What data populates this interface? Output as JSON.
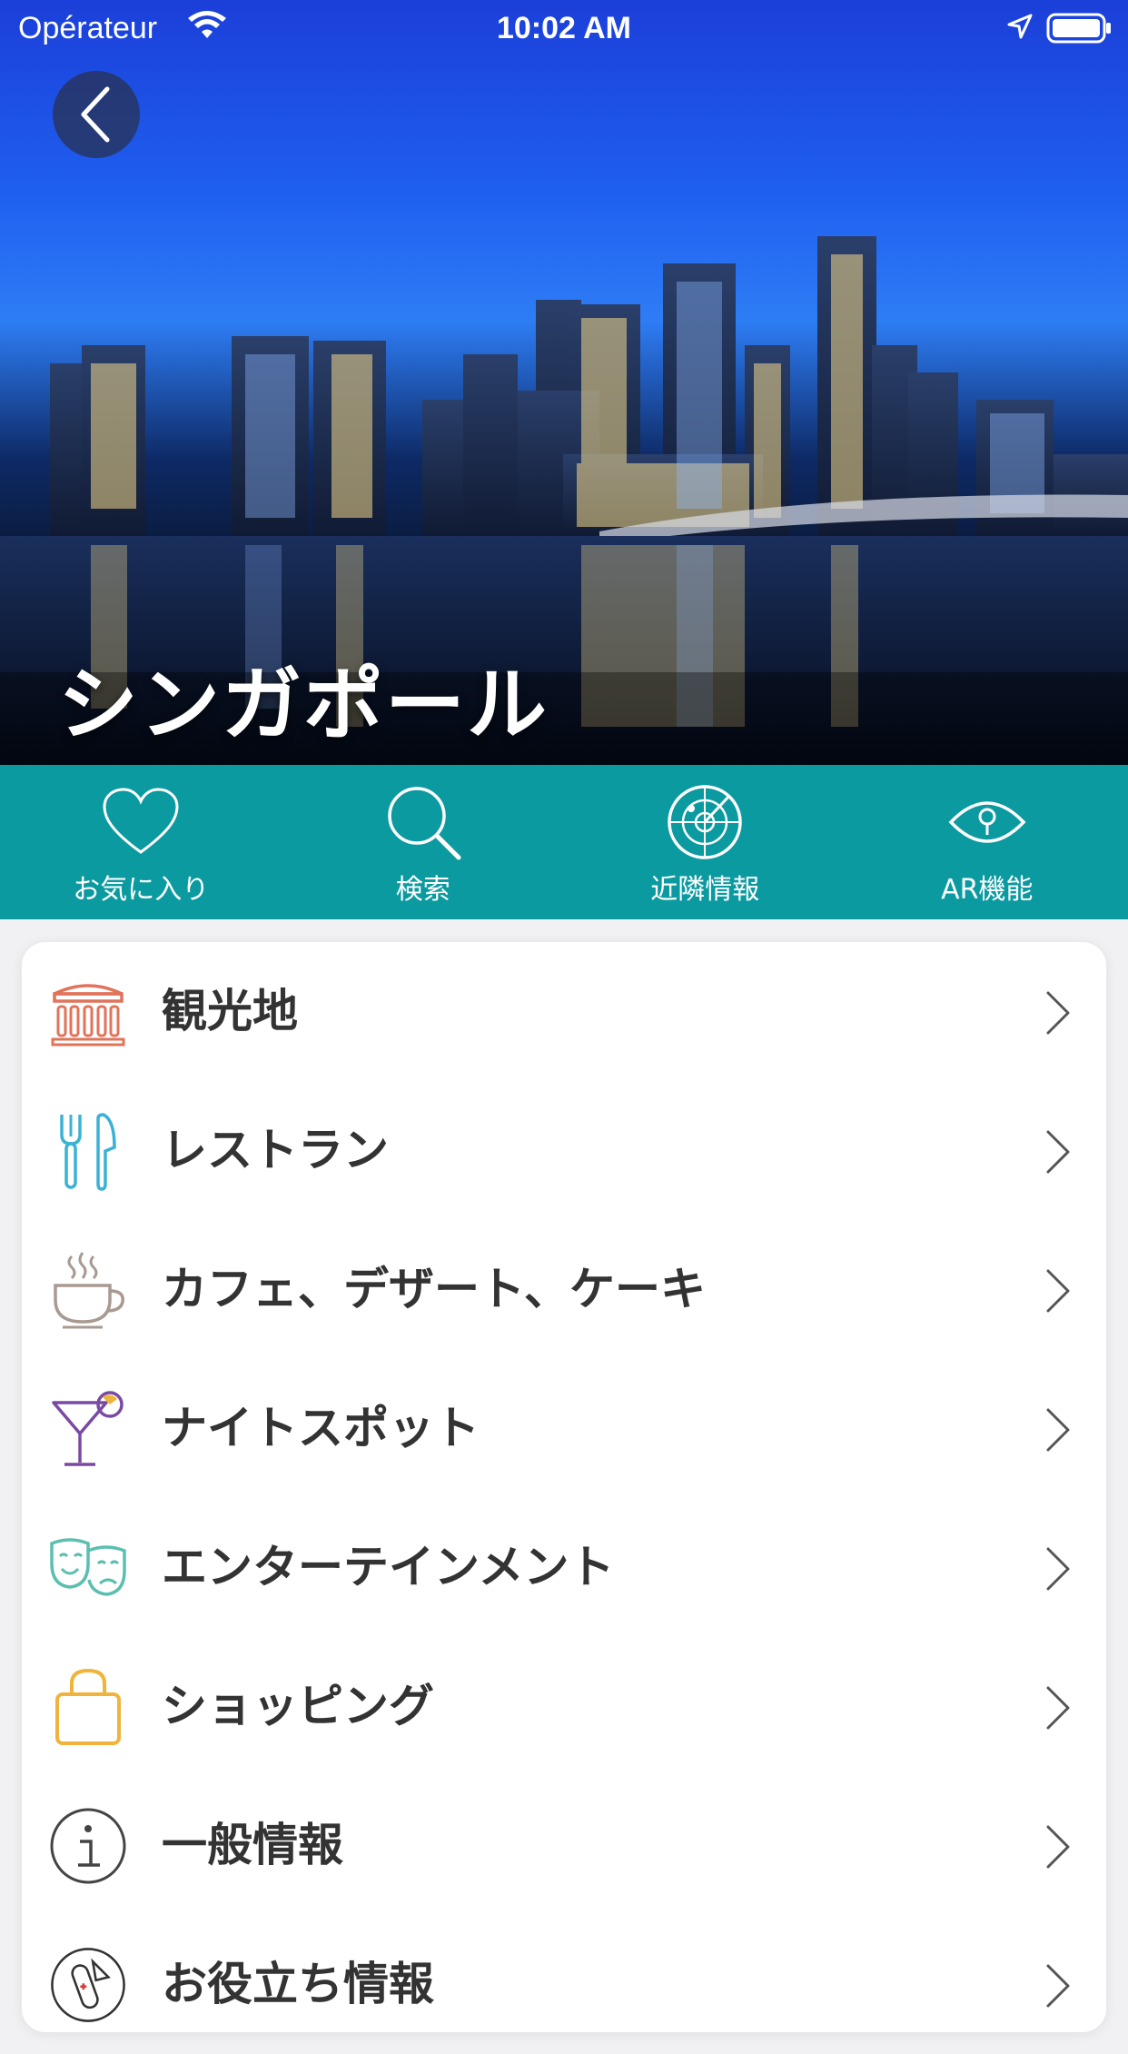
{
  "status_bar": {
    "carrier": "Opérateur",
    "time": "10:02 AM"
  },
  "hero": {
    "title": "シンガポール"
  },
  "toolbar": {
    "items": [
      {
        "label": "お気に入り",
        "icon": "heart-icon"
      },
      {
        "label": "検索",
        "icon": "search-icon"
      },
      {
        "label": "近隣情報",
        "icon": "radar-icon"
      },
      {
        "label": "AR機能",
        "icon": "eye-icon"
      }
    ]
  },
  "menu": {
    "items": [
      {
        "label": "観光地",
        "icon": "landmark-icon",
        "color": "#e0735a"
      },
      {
        "label": "レストラン",
        "icon": "fork-knife-icon",
        "color": "#3ab2d6"
      },
      {
        "label": "カフェ、デザート、ケーキ",
        "icon": "coffee-cup-icon",
        "color": "#a89a91"
      },
      {
        "label": "ナイトスポット",
        "icon": "cocktail-icon",
        "color": "#7a4aa3"
      },
      {
        "label": "エンターテインメント",
        "icon": "theater-masks-icon",
        "color": "#5bbfb0"
      },
      {
        "label": "ショッピング",
        "icon": "shopping-bag-icon",
        "color": "#f0b43c"
      },
      {
        "label": "一般情報",
        "icon": "info-icon",
        "color": "#444444"
      },
      {
        "label": "お役立ち情報",
        "icon": "swiss-knife-icon",
        "color": "#444444"
      }
    ]
  },
  "colors": {
    "toolbar_bg": "#0c9aa1",
    "page_bg": "#f1f1f3"
  }
}
